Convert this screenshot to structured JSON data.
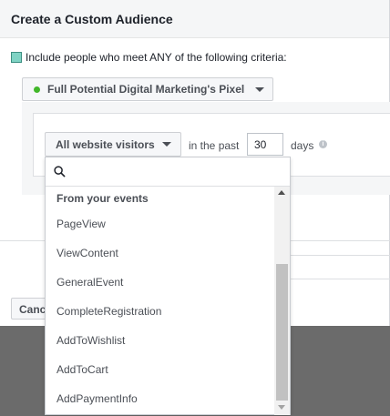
{
  "dialog": {
    "title": "Create a Custom Audience",
    "criteria_text": "Include people who meet ANY of the following criteria:",
    "pixel_name": "Full Potential Digital Marketing's Pixel",
    "visitors_label": "All website visitors",
    "past_label": "in the past",
    "days_value": "30",
    "days_label": "days",
    "cancel_label": "Cancel"
  },
  "dropdown": {
    "search_placeholder": "",
    "header": "From your events",
    "items": [
      "PageView",
      "ViewContent",
      "GeneralEvent",
      "CompleteRegistration",
      "AddToWishlist",
      "AddToCart",
      "AddPaymentInfo"
    ]
  },
  "colors": {
    "pixel_status": "#42b72a",
    "checkbox": "#7fd3c4"
  },
  "icons": {
    "search": "search-icon",
    "info": "info-icon",
    "caret": "caret-down-icon"
  }
}
